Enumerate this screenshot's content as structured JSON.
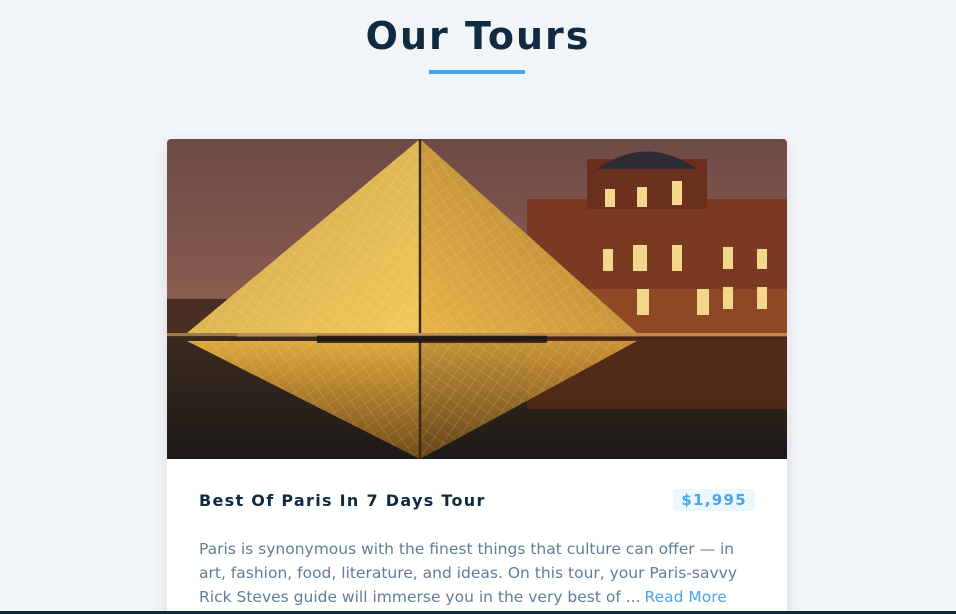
{
  "page": {
    "title": "Our Tours",
    "accent_color": "#49a6e9",
    "title_color": "#102a42"
  },
  "tour": {
    "image_alt": "Louvre pyramid at night",
    "name": "Best Of Paris In 7 Days Tour",
    "price": "$1,995",
    "info": "Paris is synonymous with the finest things that culture can offer — in art, fashion, food, literature, and ideas. On this tour, your Paris-savvy Rick Steves guide will immerse you in the very best of ...",
    "read_more": "Read More"
  }
}
